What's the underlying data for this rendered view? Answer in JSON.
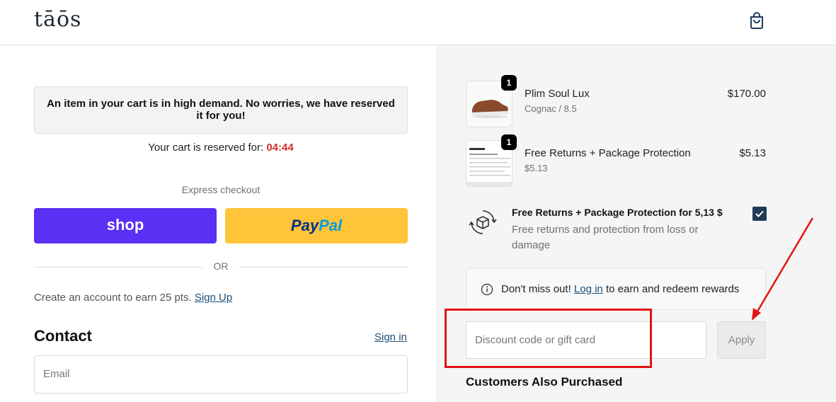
{
  "header": {
    "logo": "tāōs",
    "cart_icon": "shopping-bag-icon"
  },
  "notice": {
    "message": "An item in your cart is in high demand. No worries, we have reserved it for you!",
    "reserve_label": "Your cart is reserved for:",
    "timer": "04:44"
  },
  "express": {
    "title": "Express checkout",
    "shop_label": "shop",
    "paypal_part1": "Pay",
    "paypal_part2": "Pal"
  },
  "divider": {
    "or": "OR"
  },
  "account": {
    "text": "Create an account to earn 25 pts.",
    "signup": "Sign Up"
  },
  "contact": {
    "title": "Contact",
    "signin": "Sign in",
    "email_placeholder": "Email"
  },
  "cart": {
    "items": [
      {
        "name": "Plim Soul Lux",
        "variant": "Cognac / 8.5",
        "price": "$170.00",
        "qty": "1"
      },
      {
        "name": "Free Returns + Package Protection",
        "variant": "$5.13",
        "price": "$5.13",
        "qty": "1"
      }
    ]
  },
  "protection": {
    "title": "Free Returns + Package Protection for 5,13 $",
    "desc": "Free returns and protection from loss or damage",
    "checked": true
  },
  "rewards": {
    "prefix": "Don't miss out!",
    "link": "Log in",
    "suffix": "to earn and redeem rewards"
  },
  "discount": {
    "placeholder": "Discount code or gift card",
    "apply": "Apply"
  },
  "also_purchased": "Customers Also Purchased",
  "colors": {
    "shop": "#5a31f4",
    "paypal": "#ffc439",
    "timer": "#d62c2c",
    "annotation": "#e21414"
  }
}
